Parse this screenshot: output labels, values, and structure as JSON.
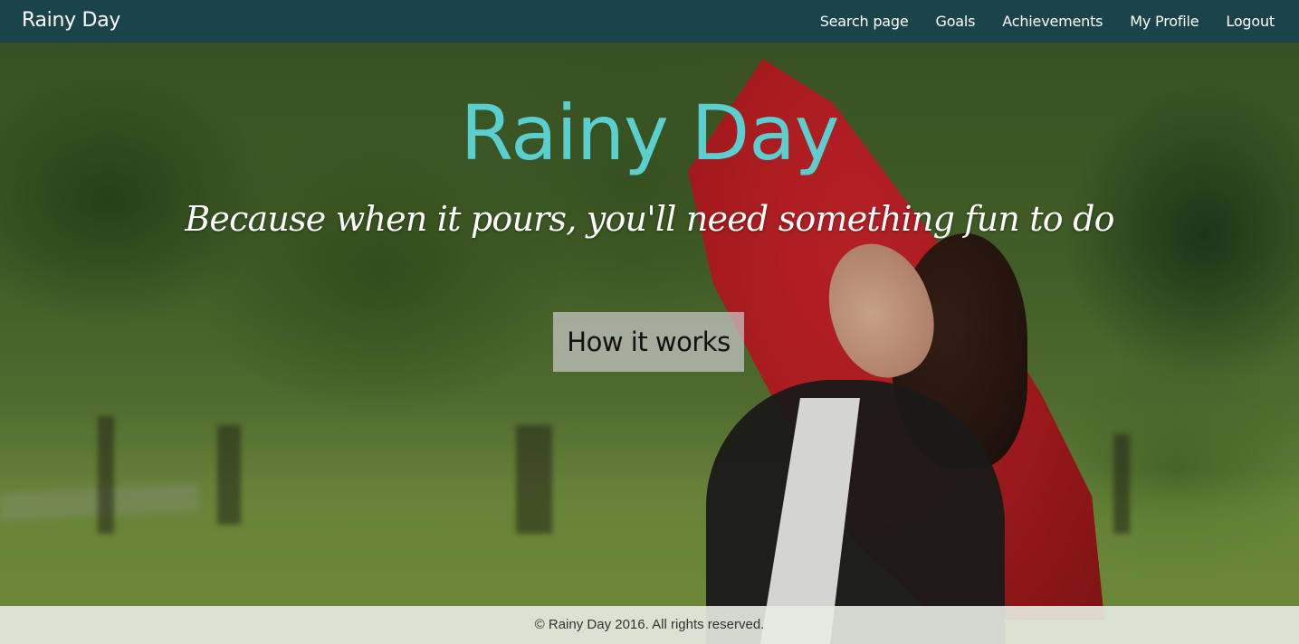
{
  "navbar": {
    "brand": "Rainy Day",
    "links": [
      {
        "label": "Search page"
      },
      {
        "label": "Goals"
      },
      {
        "label": "Achievements"
      },
      {
        "label": "My Profile"
      },
      {
        "label": "Logout"
      }
    ]
  },
  "hero": {
    "title": "Rainy Day",
    "tagline": "Because when it pours, you'll need something fun to do",
    "button_label": "How it works",
    "background_image": "woman-with-red-umbrella-in-park"
  },
  "footer": {
    "text": "© Rainy Day 2016. All rights reserved."
  },
  "colors": {
    "navbar_bg": "#1b434a",
    "title": "#5bcfcf",
    "footer_bg": "#e8ece2"
  }
}
